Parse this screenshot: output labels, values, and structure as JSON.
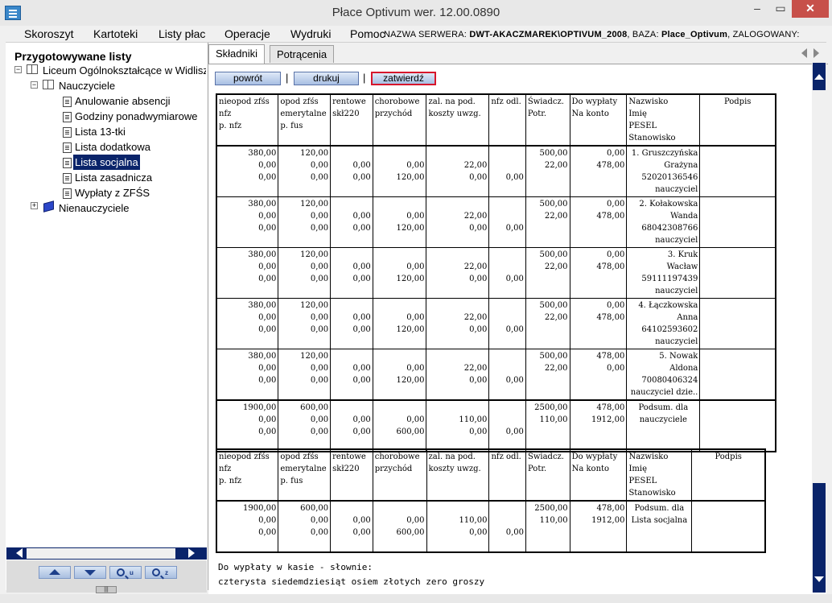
{
  "window": {
    "title": "Płace Optivum wer. 12.00.0890",
    "min": "‒",
    "max": "▭",
    "close": "✕"
  },
  "menu": [
    "Skoroszyt",
    "Kartoteki",
    "Listy płac",
    "Operacje",
    "Wydruki",
    "Pomoc"
  ],
  "server_info": {
    "server_label": "NAZWA SERWERA:",
    "server": "DWT-AKACZMAREK\\OPTIVUM_2008",
    "db_label": ", BAZA:",
    "db": "Place_Optivum",
    "user_label": ", ZALOGOWANY:"
  },
  "tree": {
    "title": "Przygotowywane listy",
    "root": "Liceum Ogólnokształcące w Widliszkach",
    "group1": "Nauczyciele",
    "items": [
      "Anulowanie absencji",
      "Godziny ponadwymiarowe",
      "Lista 13-tki",
      "Lista dodatkowa",
      "Lista socjalna",
      "Lista zasadnicza",
      "Wypłaty z ZFŚS"
    ],
    "selected_index": 4,
    "group2": "Nienauczyciele",
    "expander_minus": "−",
    "expander_plus": "+"
  },
  "nav": {
    "zoom_in": "u",
    "zoom_out": "z",
    "grip": "|||"
  },
  "tabs": [
    "Składniki",
    "Potrącenia"
  ],
  "actions": {
    "back": "powrót",
    "print": "drukuj",
    "confirm": "zatwierdź",
    "sep": "|"
  },
  "columns": [
    [
      "nieopod zfśs",
      "nfz",
      "p. nfz"
    ],
    [
      "opod zfśs",
      "emerytalne",
      "p. fus"
    ],
    [
      "rentowe",
      "skł220"
    ],
    [
      "chorobowe",
      "przychód"
    ],
    [
      "zal. na pod.",
      "koszty uwzg."
    ],
    [
      "nfz odl."
    ],
    [
      "Świadcz.",
      "Potr."
    ],
    [
      "Do wypłaty",
      "Na konto"
    ],
    [
      "Nazwisko",
      "Imię",
      "PESEL",
      "Stanowisko"
    ],
    [
      "Podpis"
    ]
  ],
  "rows": [
    {
      "c": [
        [
          "380,00",
          "0,00",
          "0,00"
        ],
        [
          "120,00",
          "0,00",
          "0,00"
        ],
        [
          "",
          "0,00",
          "0,00"
        ],
        [
          "",
          "0,00",
          "120,00"
        ],
        [
          "",
          "22,00",
          "0,00"
        ],
        [
          "",
          "",
          "0,00"
        ],
        [
          "500,00",
          "22,00"
        ],
        [
          "0,00",
          "478,00"
        ]
      ],
      "person": [
        "1. Gruszczyńska",
        "Grażyna",
        "52020136546",
        "nauczyciel"
      ]
    },
    {
      "c": [
        [
          "380,00",
          "0,00",
          "0,00"
        ],
        [
          "120,00",
          "0,00",
          "0,00"
        ],
        [
          "",
          "0,00",
          "0,00"
        ],
        [
          "",
          "0,00",
          "120,00"
        ],
        [
          "",
          "22,00",
          "0,00"
        ],
        [
          "",
          "",
          "0,00"
        ],
        [
          "500,00",
          "22,00"
        ],
        [
          "0,00",
          "478,00"
        ]
      ],
      "person": [
        "2. Kołakowska",
        "Wanda",
        "68042308766",
        "nauczyciel"
      ]
    },
    {
      "c": [
        [
          "380,00",
          "0,00",
          "0,00"
        ],
        [
          "120,00",
          "0,00",
          "0,00"
        ],
        [
          "",
          "0,00",
          "0,00"
        ],
        [
          "",
          "0,00",
          "120,00"
        ],
        [
          "",
          "22,00",
          "0,00"
        ],
        [
          "",
          "",
          "0,00"
        ],
        [
          "500,00",
          "22,00"
        ],
        [
          "0,00",
          "478,00"
        ]
      ],
      "person": [
        "3. Kruk",
        "Wacław",
        "59111197439",
        "nauczyciel"
      ]
    },
    {
      "c": [
        [
          "380,00",
          "0,00",
          "0,00"
        ],
        [
          "120,00",
          "0,00",
          "0,00"
        ],
        [
          "",
          "0,00",
          "0,00"
        ],
        [
          "",
          "0,00",
          "120,00"
        ],
        [
          "",
          "22,00",
          "0,00"
        ],
        [
          "",
          "",
          "0,00"
        ],
        [
          "500,00",
          "22,00"
        ],
        [
          "0,00",
          "478,00"
        ]
      ],
      "person": [
        "4. Łączkowska",
        "Anna",
        "64102593602",
        "nauczyciel"
      ]
    },
    {
      "c": [
        [
          "380,00",
          "0,00",
          "0,00"
        ],
        [
          "120,00",
          "0,00",
          "0,00"
        ],
        [
          "",
          "0,00",
          "0,00"
        ],
        [
          "",
          "0,00",
          "120,00"
        ],
        [
          "",
          "22,00",
          "0,00"
        ],
        [
          "",
          "",
          "0,00"
        ],
        [
          "500,00",
          "22,00"
        ],
        [
          "478,00",
          "0,00"
        ]
      ],
      "person": [
        "5. Nowak",
        "Aldona",
        "70080406324",
        "nauczyciel dzie.."
      ]
    }
  ],
  "subtotal": {
    "c": [
      [
        "1900,00",
        "0,00",
        "0,00"
      ],
      [
        "600,00",
        "0,00",
        "0,00"
      ],
      [
        "",
        "0,00",
        "0,00"
      ],
      [
        "",
        "0,00",
        "600,00"
      ],
      [
        "",
        "110,00",
        "0,00"
      ],
      [
        "",
        "",
        "0,00"
      ],
      [
        "2500,00",
        "110,00"
      ],
      [
        "478,00",
        "1912,00"
      ]
    ],
    "label": [
      "Podsum. dla",
      "nauczyciele"
    ]
  },
  "total": {
    "c": [
      [
        "1900,00",
        "0,00",
        "0,00"
      ],
      [
        "600,00",
        "0,00",
        "0,00"
      ],
      [
        "",
        "0,00",
        "0,00"
      ],
      [
        "",
        "0,00",
        "600,00"
      ],
      [
        "",
        "110,00",
        "0,00"
      ],
      [
        "",
        "",
        "0,00"
      ],
      [
        "2500,00",
        "110,00"
      ],
      [
        "478,00",
        "1912,00"
      ]
    ],
    "label": [
      "Podsum. dla",
      "Lista socjalna"
    ]
  },
  "slownie": {
    "line1": "Do wypłaty w kasie - słownie:",
    "line2": "czterysta siedemdziesiąt osiem złotych zero groszy"
  }
}
